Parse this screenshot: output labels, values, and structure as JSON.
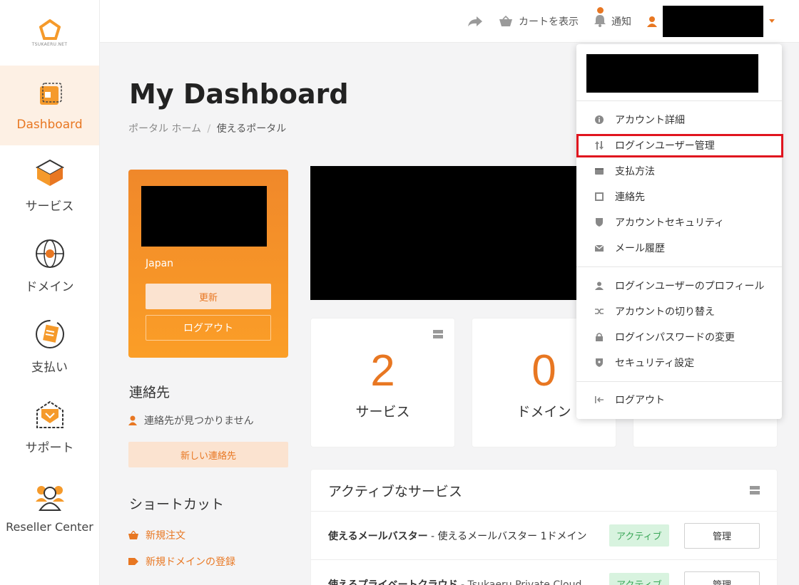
{
  "logo": {
    "text": "TSUKAERU.NET"
  },
  "sidebar": {
    "items": [
      {
        "label": "Dashboard",
        "icon": "dashboard-icon"
      },
      {
        "label": "サービス",
        "icon": "service-box-icon"
      },
      {
        "label": "ドメイン",
        "icon": "globe-icon"
      },
      {
        "label": "支払い",
        "icon": "billing-icon"
      },
      {
        "label": "サポート",
        "icon": "support-envelope-icon"
      },
      {
        "label": "Reseller Center",
        "icon": "reseller-users-icon"
      }
    ]
  },
  "topbar": {
    "cart_label": "カートを表示",
    "notify_label": "通知"
  },
  "page": {
    "title": "My Dashboard",
    "breadcrumb_home": "ポータル ホーム",
    "breadcrumb_sep": "/",
    "breadcrumb_current": "使えるポータル"
  },
  "profile": {
    "country": "Japan",
    "update_label": "更新",
    "logout_label": "ログアウト"
  },
  "contacts": {
    "title": "連絡先",
    "empty_text": "連絡先が見つかりません",
    "new_label": "新しい連絡先"
  },
  "shortcuts": {
    "title": "ショートカット",
    "items": [
      "新規注文",
      "新規ドメインの登録"
    ]
  },
  "stats": [
    {
      "value": "2",
      "label": "サービス"
    },
    {
      "value": "0",
      "label": "ドメイン"
    }
  ],
  "services": {
    "title": "アクティブなサービス",
    "rows": [
      {
        "name": "使えるメールバスター",
        "desc": " - 使えるメールバスター 1ドメイン",
        "status": "アクティブ",
        "action": "管理"
      },
      {
        "name": "使えるプライベートクラウド",
        "desc": " - Tsukaeru Private Cloud",
        "status": "アクティブ",
        "action": "管理"
      }
    ]
  },
  "dropdown": {
    "items": [
      {
        "label": "アカウント詳細",
        "icon": "info-icon"
      },
      {
        "label": "ログインユーザー管理",
        "icon": "sort-arrows-icon"
      },
      {
        "label": "支払方法",
        "icon": "wallet-icon"
      },
      {
        "label": "連絡先",
        "icon": "contact-square-icon"
      },
      {
        "label": "アカウントセキュリティ",
        "icon": "shield-icon"
      },
      {
        "label": "メール履歴",
        "icon": "envelope-icon"
      },
      {
        "label": "ログインユーザーのプロフィール",
        "icon": "user-icon"
      },
      {
        "label": "アカウントの切り替え",
        "icon": "shuffle-icon"
      },
      {
        "label": "ログインパスワードの変更",
        "icon": "lock-icon"
      },
      {
        "label": "セキュリティ設定",
        "icon": "shield-check-icon"
      },
      {
        "label": "ログアウト",
        "icon": "logout-icon"
      }
    ]
  },
  "colors": {
    "accent": "#e87722",
    "highlight": "#e0141e",
    "active_bg": "#fdf0e4"
  }
}
